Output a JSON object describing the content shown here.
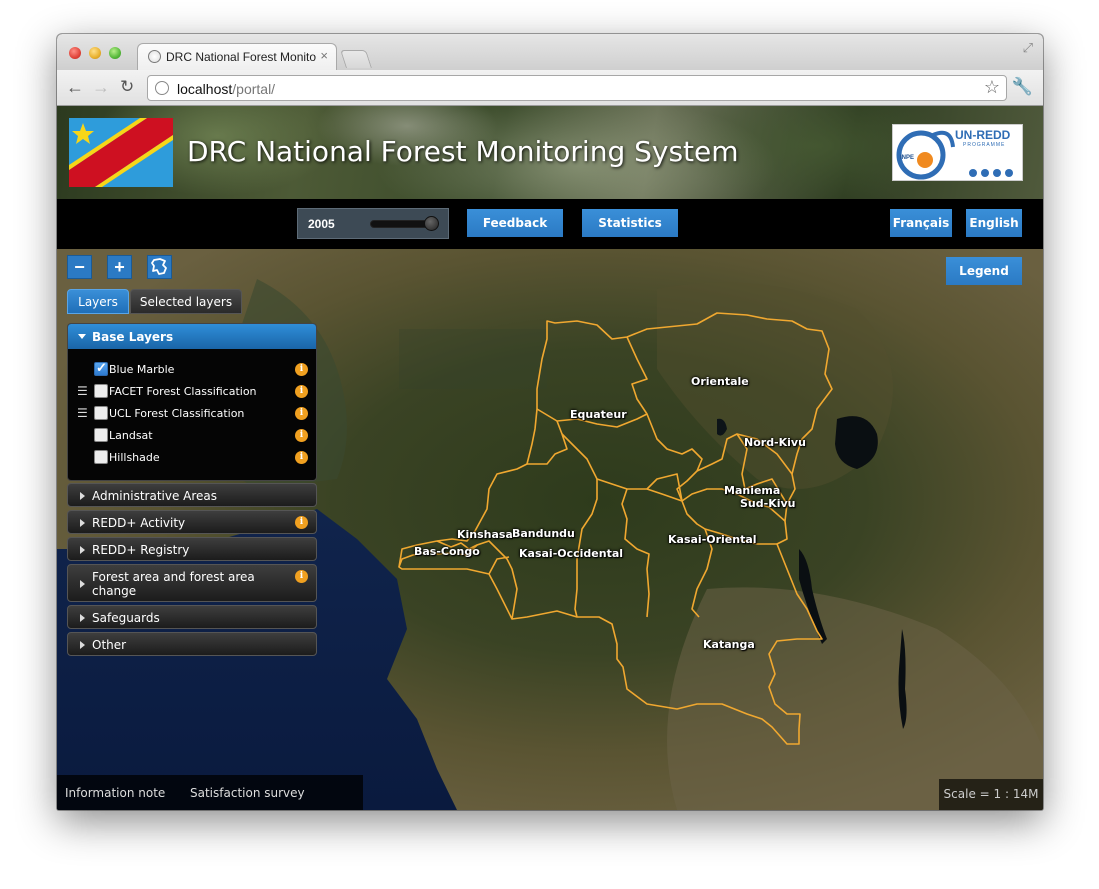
{
  "browser": {
    "tab_title": "DRC National Forest Monitoring System",
    "tab_close": "×",
    "url_host": "localhost",
    "url_path": "/portal/"
  },
  "header": {
    "title": "DRC National Forest Monitoring System",
    "logo": {
      "brand": "UN-REDD",
      "sub": "PROGRAMME",
      "org": "INPE"
    }
  },
  "controls": {
    "year": "2005",
    "year_slider_level": 1.0,
    "feedback_label": "Feedback",
    "statistics_label": "Statistics",
    "french_label": "Français",
    "english_label": "English"
  },
  "map_tools": {
    "zoom_out": "−",
    "zoom_in": "+",
    "legend_label": "Legend"
  },
  "layer_tabs": {
    "layers": "Layers",
    "selected": "Selected layers"
  },
  "base_layers": {
    "title": "Base Layers",
    "items": [
      {
        "label": "Blue Marble",
        "checked": true,
        "has_legend": false
      },
      {
        "label": "FACET Forest Classification",
        "checked": false,
        "has_legend": true
      },
      {
        "label": "UCL Forest Classification",
        "checked": false,
        "has_legend": true
      },
      {
        "label": "Landsat",
        "checked": false,
        "has_legend": false
      },
      {
        "label": "Hillshade",
        "checked": false,
        "has_legend": false
      }
    ]
  },
  "groups": [
    {
      "label": "Administrative Areas",
      "info": false
    },
    {
      "label": "REDD+ Activity",
      "info": true
    },
    {
      "label": "REDD+ Registry",
      "info": false
    },
    {
      "label": "Forest area and forest area change",
      "info": true
    },
    {
      "label": "Safeguards",
      "info": false
    },
    {
      "label": "Other",
      "info": false
    }
  ],
  "info_glyph": "i",
  "provinces": [
    "Orientale",
    "Equateur",
    "Nord-Kivu",
    "Maniema",
    "Sud-Kivu",
    "Kinshasa",
    "Bandundu",
    "Bas-Congo",
    "Kasai-Occidental",
    "Kasai-Oriental",
    "Katanga"
  ],
  "footer": {
    "info_note": "Information note",
    "survey": "Satisfaction survey",
    "scale": "Scale = 1 : 14M"
  },
  "colors": {
    "accent_blue": "#2b7ac4",
    "boundary": "#f0a830",
    "info_orange": "#f0a020"
  }
}
